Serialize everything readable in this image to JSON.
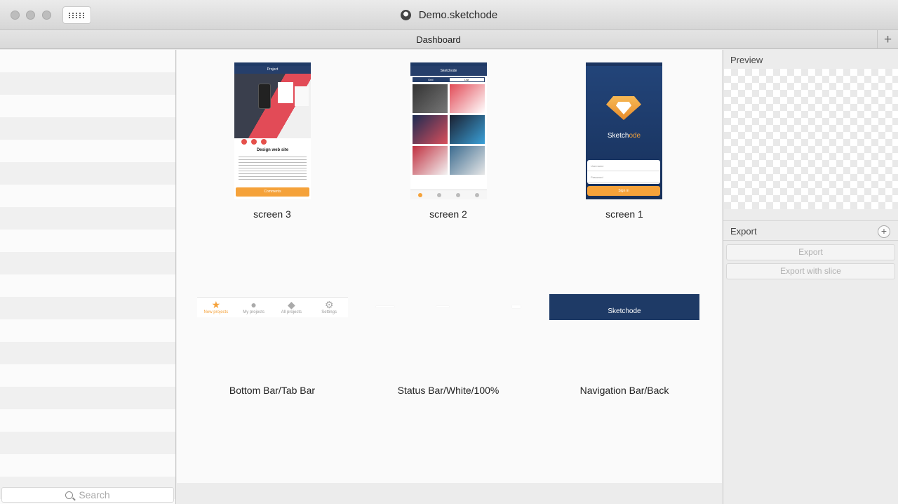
{
  "window": {
    "title": "Demo.sketchode"
  },
  "tabs": {
    "active": "Dashboard",
    "add_icon": "plus-icon"
  },
  "sidebar": {
    "search_placeholder": "Search"
  },
  "artboards": [
    {
      "name": "screen 3",
      "nav_title": "Project",
      "heading": "Design web site",
      "button": "Comments"
    },
    {
      "name": "screen 2",
      "nav_title": "Sketchode",
      "segments": [
        "Grid",
        "List"
      ]
    },
    {
      "name": "screen 1",
      "brand_a": "Sketch",
      "brand_b": "ode",
      "username_placeholder": "Username",
      "password_placeholder": "Password",
      "button": "Sign in"
    },
    {
      "name": "Bottom Bar/Tab Bar",
      "tabs": [
        "New projects",
        "My projects",
        "All projects",
        "Settings"
      ]
    },
    {
      "name": "Status Bar/White/100%"
    },
    {
      "name": "Navigation Bar/Back",
      "title": "Sketchode"
    }
  ],
  "right_panel": {
    "preview_label": "Preview",
    "export_label": "Export",
    "export_button": "Export",
    "export_slice_button": "Export with slice"
  },
  "colors": {
    "brand_navy": "#1e3a66",
    "accent_orange": "#f5a23a"
  }
}
